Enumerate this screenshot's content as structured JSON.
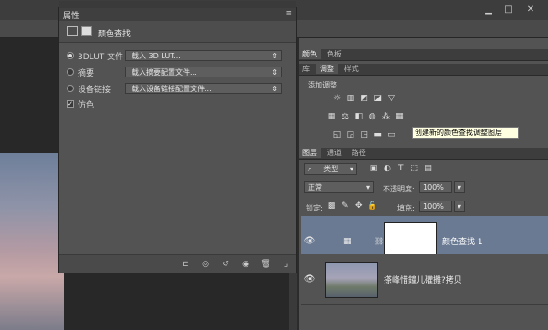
{
  "window": {
    "min_icon": "minimize-icon",
    "max_icon": "maximize-icon",
    "close_icon": "close-icon"
  },
  "properties": {
    "title": "属性",
    "adjustment_name": "颜色查找",
    "rows": [
      {
        "label": "3DLUT 文件",
        "value": "载入 3D LUT...",
        "selected": true
      },
      {
        "label": "摘要",
        "value": "载入摘要配置文件...",
        "selected": false
      },
      {
        "label": "设备链接",
        "value": "载入设备链接配置文件...",
        "selected": false
      }
    ],
    "dither_label": "仿色",
    "dither_checked": true
  },
  "right": {
    "tabs1": [
      "颜色",
      "色板"
    ],
    "tabs2": [
      "库",
      "调整",
      "样式"
    ],
    "adjust_heading": "添加调整",
    "tooltip": "创建新的颜色查找调整图层",
    "layer_tabs": [
      "图层",
      "通道",
      "路径"
    ],
    "filter_label": "类型",
    "blend_mode": "正常",
    "opacity_label": "不透明度:",
    "opacity_value": "100%",
    "lock_label": "锁定:",
    "fill_label": "填充:",
    "fill_value": "100%",
    "layers": [
      {
        "name": "颜色查找 1"
      },
      {
        "name": "搽峰惜鐘儿礶攤?拷贝"
      }
    ]
  }
}
